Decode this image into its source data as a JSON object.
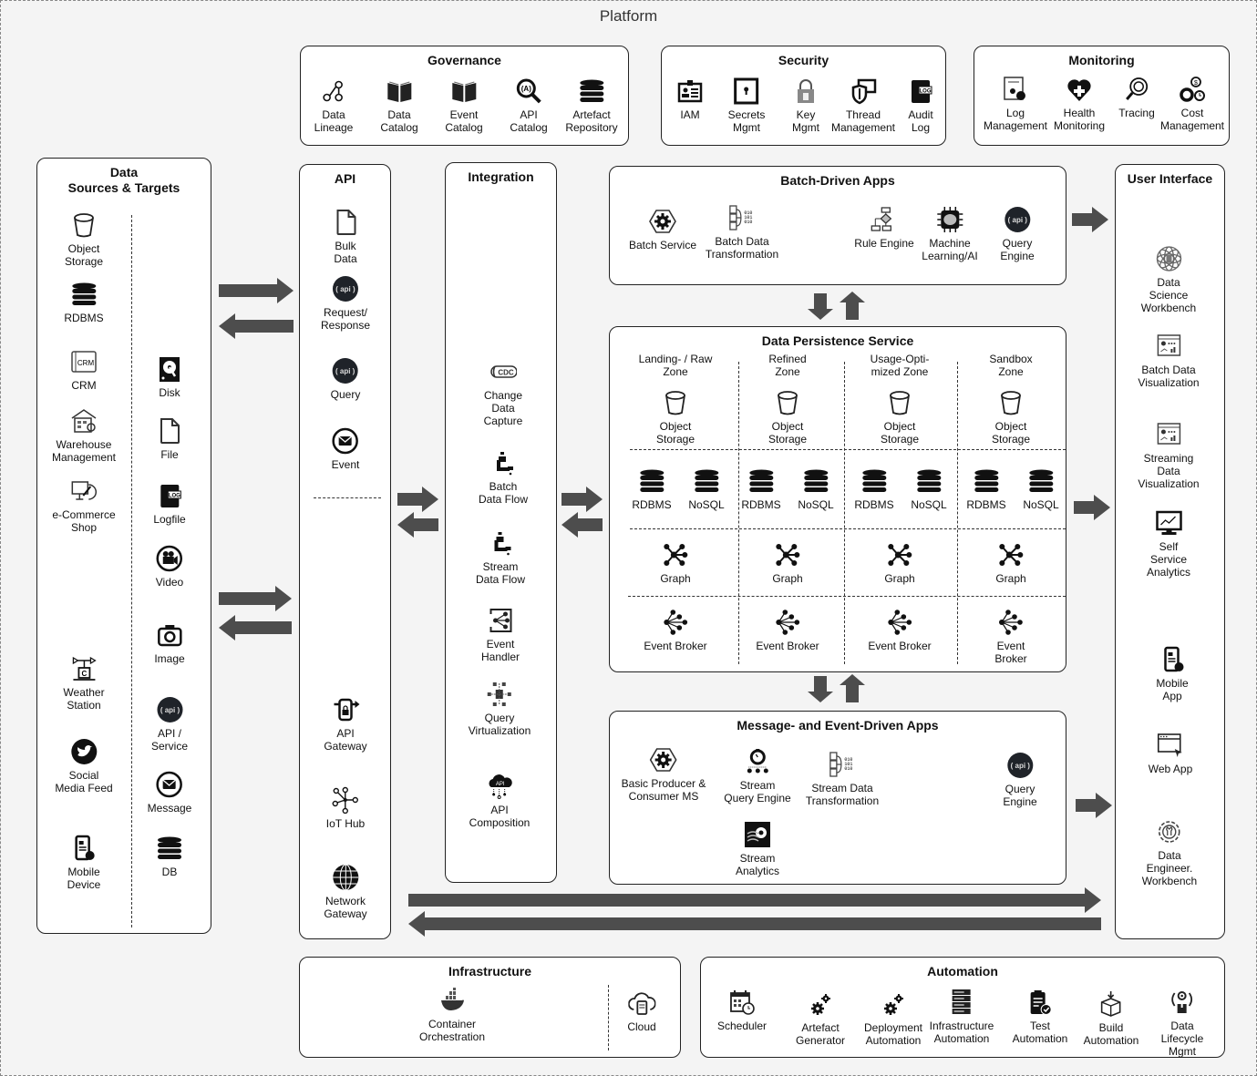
{
  "platform": {
    "title": "Platform"
  },
  "colors": {
    "arrow": "#4d4d4d",
    "box_border": "#222222",
    "background": "#f4f4f4"
  },
  "governance": {
    "title": "Governance",
    "items": [
      {
        "label": "Data\nLineage",
        "icon": "lineage-icon"
      },
      {
        "label": "Data\nCatalog",
        "icon": "book-icon"
      },
      {
        "label": "Event\nCatalog",
        "icon": "book-icon"
      },
      {
        "label": "API\nCatalog",
        "icon": "api-search-icon"
      },
      {
        "label": "Artefact\nRepository",
        "icon": "database-icon"
      }
    ]
  },
  "security": {
    "title": "Security",
    "items": [
      {
        "label": "IAM",
        "icon": "id-badge-icon"
      },
      {
        "label": "Secrets\nMgmt",
        "icon": "safe-icon"
      },
      {
        "label": "Key\nMgmt",
        "icon": "padlock-icon"
      },
      {
        "label": "Thread\nManagement",
        "icon": "shield-monitor-icon"
      },
      {
        "label": "Audit\nLog",
        "icon": "log-icon"
      }
    ]
  },
  "monitoring": {
    "title": "Monitoring",
    "items": [
      {
        "label": "Log\nManagement",
        "icon": "log-gear-icon"
      },
      {
        "label": "Health\nMonitoring",
        "icon": "heart-plus-icon"
      },
      {
        "label": "Tracing",
        "icon": "tracing-icon"
      },
      {
        "label": "Cost\nManagement",
        "icon": "cost-gear-icon"
      }
    ]
  },
  "sources": {
    "title": "Data\nSources & Targets",
    "left": [
      {
        "label": "Object\nStorage",
        "icon": "bucket-icon"
      },
      {
        "label": "RDBMS",
        "icon": "database-icon"
      },
      {
        "label": "CRM",
        "icon": "crm-icon"
      },
      {
        "label": "Warehouse\nManagement",
        "icon": "warehouse-icon"
      },
      {
        "label": "e-Commerce\nShop",
        "icon": "ecommerce-icon"
      },
      {
        "label": "Weather\nStation",
        "icon": "weather-station-icon"
      },
      {
        "label": "Social\nMedia Feed",
        "icon": "twitter-icon"
      },
      {
        "label": "Mobile\nDevice",
        "icon": "mobile-icon"
      }
    ],
    "right": [
      {
        "label": "Disk",
        "icon": "disk-icon"
      },
      {
        "label": "File",
        "icon": "file-icon"
      },
      {
        "label": "Logfile",
        "icon": "log-icon"
      },
      {
        "label": "Video",
        "icon": "video-icon"
      },
      {
        "label": "Image",
        "icon": "camera-icon"
      },
      {
        "label": "API / Service",
        "icon": "api-icon"
      },
      {
        "label": "Message",
        "icon": "envelope-icon"
      },
      {
        "label": "DB",
        "icon": "database-icon"
      }
    ]
  },
  "api": {
    "title": "API",
    "items": [
      {
        "label": "Bulk Data",
        "icon": "file-icon"
      },
      {
        "label": "Request/\nResponse",
        "icon": "api-icon"
      },
      {
        "label": "Query",
        "icon": "api-icon"
      },
      {
        "label": "Event",
        "icon": "envelope-icon"
      },
      {
        "label": "API Gateway",
        "icon": "api-gateway-icon"
      },
      {
        "label": "IoT Hub",
        "icon": "iot-hub-icon"
      },
      {
        "label": "Network\nGateway",
        "icon": "globe-icon"
      }
    ]
  },
  "integration": {
    "title": "Integration",
    "items": [
      {
        "label": "Change\nData Capture",
        "icon": "cdc-icon"
      },
      {
        "label": "Batch Data Flow",
        "icon": "pipe-icon"
      },
      {
        "label": "Stream Data Flow",
        "icon": "pipe-icon"
      },
      {
        "label": "Event Handler",
        "icon": "event-handler-icon"
      },
      {
        "label": "Query\nVirtualization",
        "icon": "query-virtualization-icon"
      },
      {
        "label": "API Composition",
        "icon": "api-cloud-icon"
      }
    ]
  },
  "batch_apps": {
    "title": "Batch-Driven Apps",
    "items": [
      {
        "label": "Batch Service",
        "icon": "hex-gear-icon"
      },
      {
        "label": "Batch Data\nTransformation",
        "icon": "transformation-icon"
      },
      {
        "label": "Rule Engine",
        "icon": "flowchart-icon"
      },
      {
        "label": "Machine\nLearning/AI",
        "icon": "chip-brain-icon"
      },
      {
        "label": "Query\nEngine",
        "icon": "api-icon"
      }
    ]
  },
  "persistence": {
    "title": "Data Persistence Service",
    "zones": [
      {
        "name": "Landing- / Raw\nZone",
        "storage": "Object\nStorage",
        "rdbms": "RDBMS",
        "nosql": "NoSQL",
        "graph": "Graph",
        "broker": "Event Broker"
      },
      {
        "name": "Refined\nZone",
        "storage": "Object\nStorage",
        "rdbms": "RDBMS",
        "nosql": "NoSQL",
        "graph": "Graph",
        "broker": "Event Broker"
      },
      {
        "name": "Usage-Opti-\nmized Zone",
        "storage": "Object\nStorage",
        "rdbms": "RDBMS",
        "nosql": "NoSQL",
        "graph": "Graph",
        "broker": "Event Broker"
      },
      {
        "name": "Sandbox\nZone",
        "storage": "Object\nStorage",
        "rdbms": "RDBMS",
        "nosql": "NoSQL",
        "graph": "Graph",
        "broker": "Event Broker"
      }
    ]
  },
  "event_apps": {
    "title": "Message- and Event-Driven Apps",
    "items": [
      {
        "label": "Basic Producer &\nConsumer MS",
        "icon": "hex-gear-icon"
      },
      {
        "label": "Stream\nQuery Engine",
        "icon": "stopwatch-icon"
      },
      {
        "label": "Stream Data\nTransformation",
        "icon": "transformation-icon"
      },
      {
        "label": "Query\nEngine",
        "icon": "api-icon"
      },
      {
        "label": "Stream\nAnalytics",
        "icon": "stream-gear-icon"
      }
    ]
  },
  "ui": {
    "title": "User Interface",
    "items": [
      {
        "label": "Data Science\nWorkbench",
        "icon": "atom-icon"
      },
      {
        "label": "Batch Data\nVisualization",
        "icon": "dashboard-icon"
      },
      {
        "label": "Streaming Data\nVisualization",
        "icon": "dashboard-icon"
      },
      {
        "label": "Self Service\nAnalytics",
        "icon": "monitor-chart-icon"
      },
      {
        "label": "Mobile App",
        "icon": "mobile-icon"
      },
      {
        "label": "Web App",
        "icon": "web-app-icon"
      },
      {
        "label": "Data Engineer.\nWorkbench",
        "icon": "wrench-gear-icon"
      }
    ]
  },
  "infrastructure": {
    "title": "Infrastructure",
    "items": [
      {
        "label": "Container\nOrchestration",
        "icon": "docker-icon"
      },
      {
        "label": "Cloud",
        "icon": "cloud-icon"
      }
    ]
  },
  "automation": {
    "title": "Automation",
    "items": [
      {
        "label": "Scheduler",
        "icon": "calendar-clock-icon"
      },
      {
        "label": "Artefact\nGenerator",
        "icon": "gears-icon"
      },
      {
        "label": "Deployment\nAutomation",
        "icon": "gears-icon"
      },
      {
        "label": "Infrastructure\nAutomation",
        "icon": "server-rack-icon"
      },
      {
        "label": "Test\nAutomation",
        "icon": "clipboard-check-icon"
      },
      {
        "label": "Build\nAutomation",
        "icon": "box-icon"
      },
      {
        "label": "Data Lifecycle\nMgmt",
        "icon": "lifecycle-icon"
      }
    ]
  }
}
